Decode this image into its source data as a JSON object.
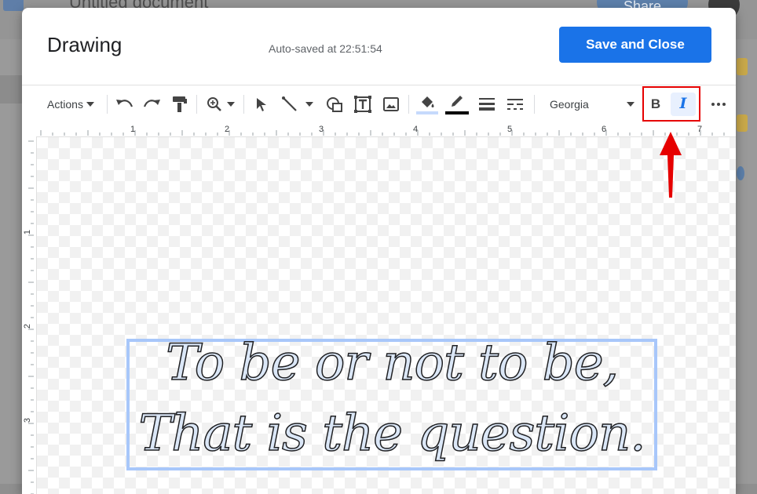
{
  "background": {
    "doc_title": "Untitled document",
    "share_label": "Share"
  },
  "dialog": {
    "title": "Drawing",
    "autosave": "Auto-saved at 22:51:54",
    "save_label": "Save and Close"
  },
  "toolbar": {
    "actions_label": "Actions",
    "font_name": "Georgia",
    "bold_label": "B",
    "italic_label": "I",
    "icons": [
      "undo-icon",
      "redo-icon",
      "paint-format-icon",
      "zoom-icon",
      "select-icon",
      "line-icon",
      "shape-icon",
      "textbox-icon",
      "image-icon",
      "fill-color-icon",
      "border-color-icon",
      "border-weight-icon",
      "border-dash-icon",
      "more-icon"
    ],
    "colors": {
      "fill_underline": "#c6dafc",
      "border_underline": "#000000",
      "italic_active_bg": "#e8f0fe",
      "highlight": "#e60000"
    }
  },
  "ruler": {
    "top": [
      "1",
      "2",
      "3",
      "4",
      "5",
      "6",
      "7"
    ],
    "left": [
      "1",
      "2",
      "3"
    ]
  },
  "drawing": {
    "line1": "To be or not to be,",
    "line2": "That is the question."
  },
  "colors": {
    "accent": "#1a73e8",
    "selection": "#a8c7fa"
  }
}
